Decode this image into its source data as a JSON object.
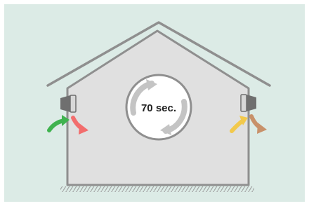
{
  "timer": {
    "label": "70 sec."
  },
  "colors": {
    "background": "#dcebe6",
    "house_fill": "#e0e0e0",
    "house_outline": "#8f8f8f",
    "circle_fill": "#ffffff",
    "cycle_arrows": "#c4c4c4",
    "fan_unit": "#6f6f6f",
    "intake_left": "#3fb34f",
    "exhaust_left": "#f26d6d",
    "intake_right": "#f2c94c",
    "exhaust_right": "#c8916a",
    "ground_hatch": "#9a9a9a"
  },
  "icons": {
    "left_unit": "ventilation-unit-icon",
    "right_unit": "ventilation-unit-icon",
    "cycle": "refresh-cycle-icon",
    "arrows": "curved-arrow-icon"
  }
}
